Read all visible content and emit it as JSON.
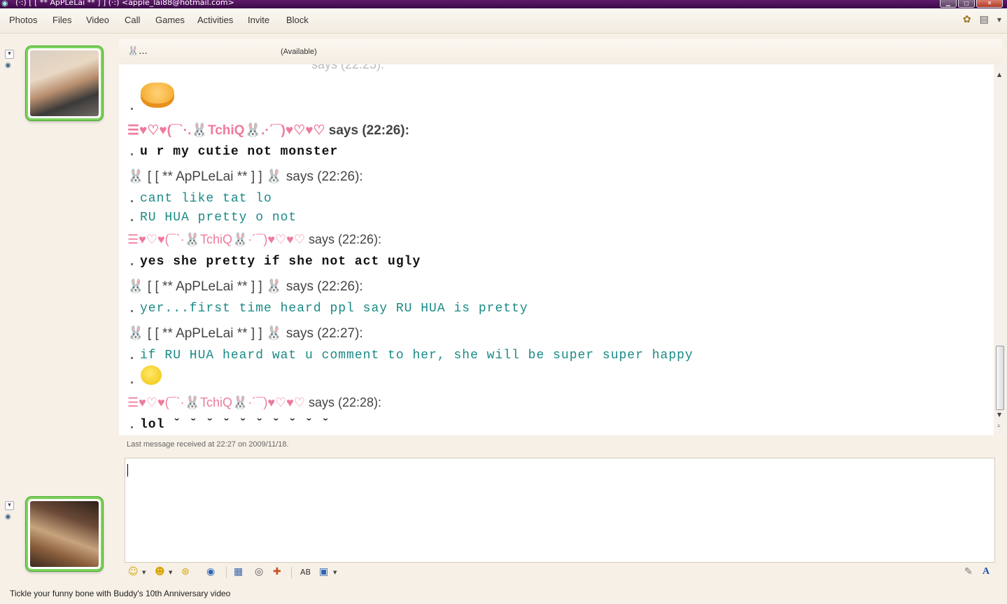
{
  "window": {
    "title": "(·:) [ [ ** ApPLeLai ** ] ] (·:) <apple_lai88@hotmail.com>"
  },
  "menu": {
    "items": [
      "Photos",
      "Files",
      "Video",
      "Call",
      "Games",
      "Activities",
      "Invite",
      "Block"
    ]
  },
  "contact": {
    "name": "🐰...",
    "status": "(Available)"
  },
  "conversation": {
    "clipped_header": "says (22:25):",
    "entries": [
      {
        "sender": "☰♥♡♥(¯`·.🐰TchiQ🐰.·´¯)♥♡♥♡",
        "says": "says (22:26):",
        "lines": [
          "u r my cutie not monster"
        ]
      },
      {
        "sender": "🐰 [ [ ** ApPLeLai ** ] ] 🐰",
        "says": "says (22:26):",
        "lines": [
          "cant like tat lo",
          "RU HUA pretty o not"
        ]
      },
      {
        "sender": "☰♥♡♥(¯`·🐰TchiQ🐰·´¯)♥♡♥♡",
        "says": "says (22:26):",
        "lines": [
          "yes she pretty if she not act ugly"
        ]
      },
      {
        "sender": "🐰 [ [ ** ApPLeLai ** ] ] 🐰",
        "says": "says (22:26):",
        "lines": [
          "yer...first time heard ppl say RU HUA is pretty"
        ]
      },
      {
        "sender": "🐰 [ [ ** ApPLeLai ** ] ] 🐰",
        "says": "says (22:27):",
        "lines": [
          "if RU HUA heard wat u comment to her, she will be super super happy"
        ]
      },
      {
        "sender": "☰♥♡♥(¯`·🐰TchiQ🐰·´¯)♥♡♥♡",
        "says": "says (22:28):",
        "lines": [
          "lol ˇ ˇ ˇ ˇ ˇ ˇ ˇ ˇ ˇ ˇ"
        ]
      }
    ]
  },
  "status_line": "Last message received at 22:27 on 2009/11/18.",
  "footer": {
    "link": "Tickle your funny bone with Buddy's 10th Anniversary video"
  },
  "colors": {
    "title_bar": "#4a1256",
    "contact_text": "#1a8a86",
    "self_text": "#111111",
    "name_decoration": "#ee7b9b",
    "avatar_frame": "#7cd35b"
  },
  "icons": {
    "toolbar": [
      "emoticon-icon",
      "wink-icon",
      "nudge-icon",
      "voice-clip-icon",
      "background-icon",
      "sound-icon",
      "games-icon",
      "font-icon",
      "share-icon",
      "handwriting-icon",
      "font-style-icon"
    ]
  }
}
